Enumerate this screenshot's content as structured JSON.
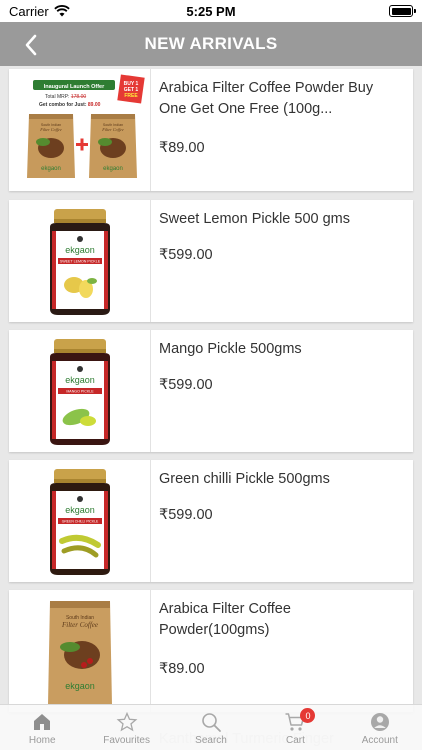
{
  "status_bar": {
    "carrier": "Carrier",
    "time": "5:25 PM"
  },
  "nav": {
    "title": "NEW ARRIVALS"
  },
  "promo": {
    "headline": "Inaugural Launch Offer",
    "total_mrp_label": "Total MRP:",
    "total_mrp_value": "178.00",
    "combo_label": "Get combo for Just:",
    "combo_value": "89.00",
    "sticker_line1": "BUY 1",
    "sticker_line2": "GET 1",
    "sticker_line3": "FREE"
  },
  "products": [
    {
      "name": "Arabica Filter Coffee Powder Buy One Get One Free (100g...",
      "price": "₹89.00",
      "image": "coffee-combo"
    },
    {
      "name": "Sweet Lemon Pickle 500 gms",
      "price": "₹599.00",
      "image": "sweet-lemon-pickle-jar",
      "label": "SWEET LEMON PICKLE"
    },
    {
      "name": "Mango Pickle 500gms",
      "price": "₹599.00",
      "image": "mango-pickle-jar",
      "label": "MANGO PICKLE"
    },
    {
      "name": "Green chilli Pickle 500gms",
      "price": "₹599.00",
      "image": "green-chilli-pickle-jar",
      "label": "GREEN CHILLI PICKLE"
    },
    {
      "name": "Arabica Filter Coffee Powder(100gms)",
      "price": "₹89.00",
      "image": "coffee-pouch"
    }
  ],
  "brand": "ekgaon",
  "pouch": {
    "line1": "South Indian",
    "line2": "Filter Coffee"
  },
  "next_item_partial": "Kanthamal Turmeric Finger",
  "tabs": [
    {
      "label": "Home",
      "icon": "home-icon",
      "active": true
    },
    {
      "label": "Favourites",
      "icon": "star-icon"
    },
    {
      "label": "Search",
      "icon": "search-icon"
    },
    {
      "label": "Cart",
      "icon": "cart-icon",
      "badge": "0"
    },
    {
      "label": "Account",
      "icon": "account-icon"
    }
  ],
  "colors": {
    "nav_bar": "#9a9a9a",
    "background": "#e8e8e8",
    "badge": "#e53935",
    "jar_label": "#c62828"
  }
}
